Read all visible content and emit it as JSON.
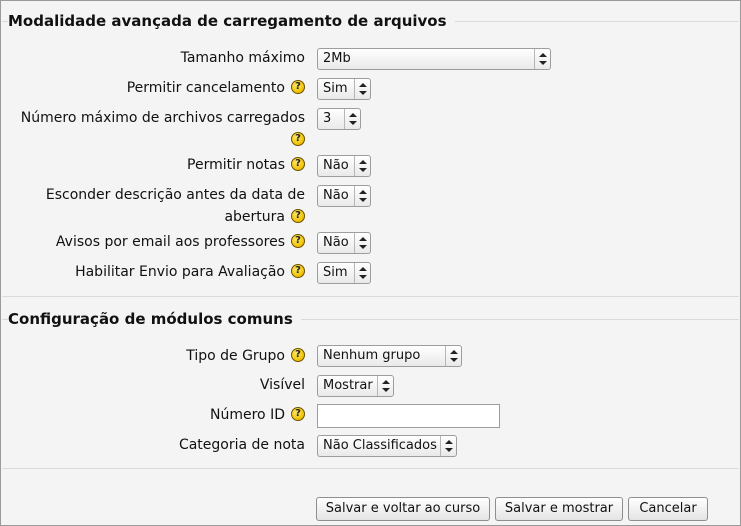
{
  "section1": {
    "legend": "Modalidade avançada de carregamento de arquivos",
    "fields": [
      {
        "label": "Tamanho máximo",
        "value": "2Mb"
      },
      {
        "label": "Permitir cancelamento",
        "value": "Sim"
      },
      {
        "label": "Número máximo de archivos carregados",
        "value": "3"
      },
      {
        "label": "Permitir notas",
        "value": "Não"
      },
      {
        "label": "Esconder descrição antes da data de abertura",
        "value": "Não"
      },
      {
        "label": "Avisos por email aos professores",
        "value": "Não"
      },
      {
        "label": "Habilitar Envio para Avaliação",
        "value": "Sim"
      }
    ]
  },
  "section2": {
    "legend": "Configuração de módulos comuns",
    "fields": [
      {
        "label": "Tipo de Grupo",
        "value": "Nenhum grupo"
      },
      {
        "label": "Visível",
        "value": "Mostrar"
      },
      {
        "label": "Número ID",
        "value": ""
      },
      {
        "label": "Categoria de nota",
        "value": "Não Classificados"
      }
    ]
  },
  "help_glyph": "?",
  "buttons": {
    "save_return": "Salvar e voltar ao curso",
    "save_display": "Salvar e mostrar",
    "cancel": "Cancelar"
  }
}
